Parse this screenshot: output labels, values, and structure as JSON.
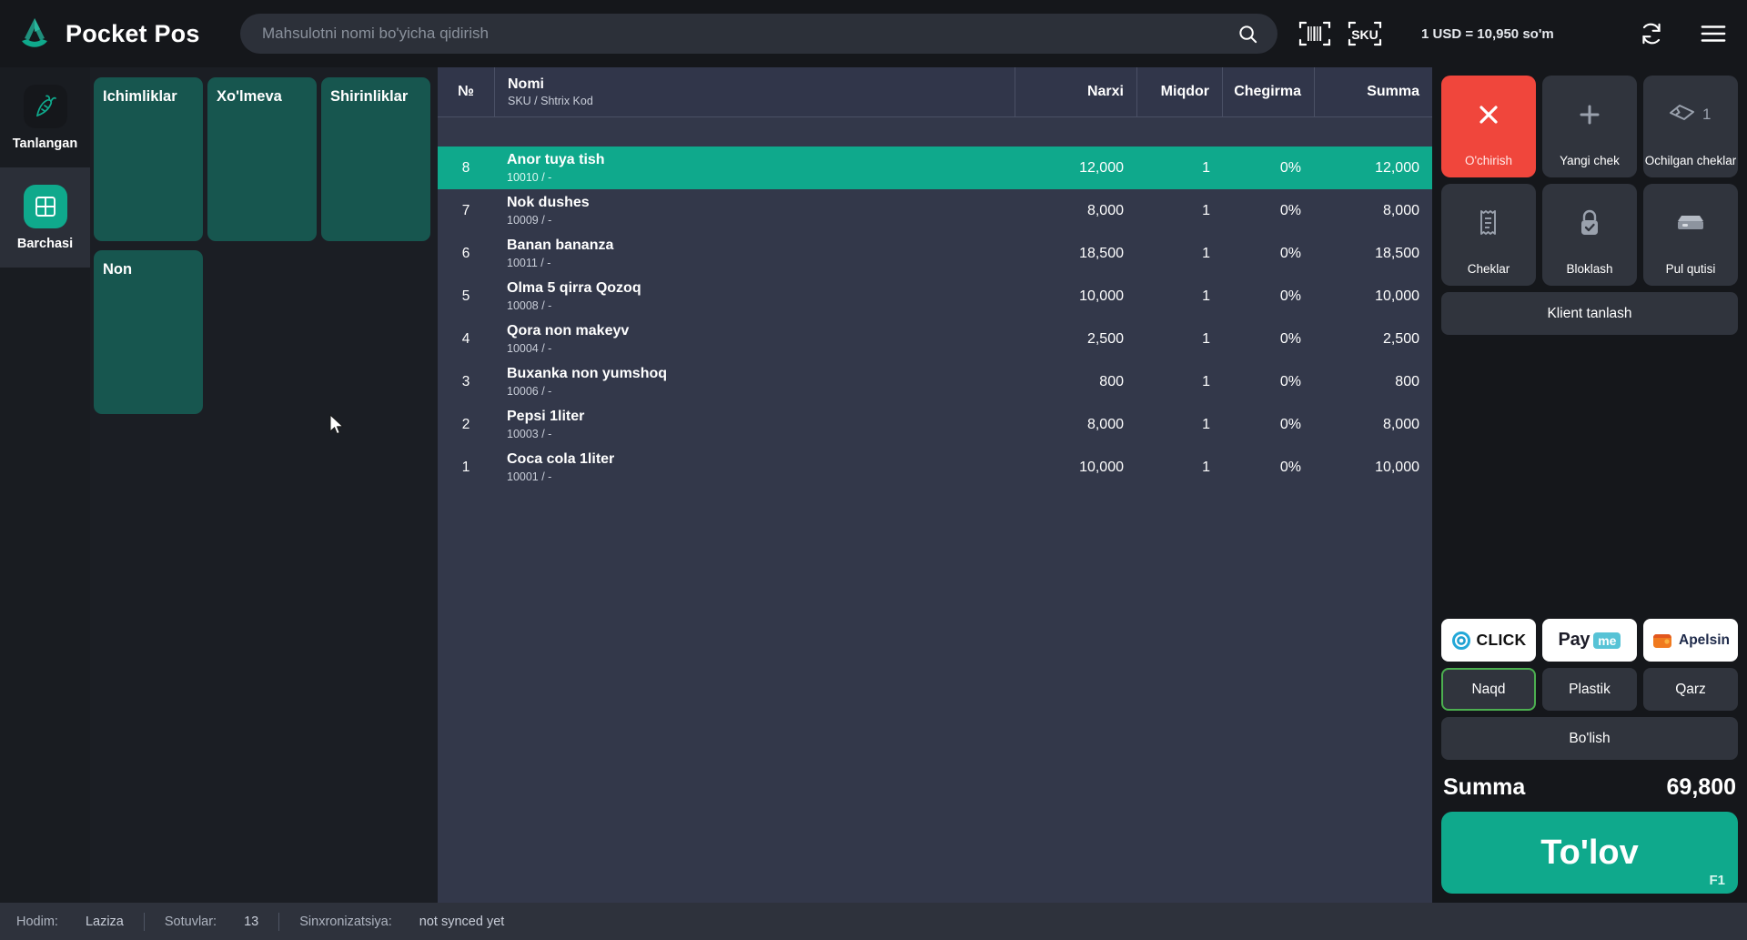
{
  "header": {
    "brand": "Pocket Pos",
    "search_placeholder": "Mahsulotni nomi bo'yicha qidirish",
    "search_value": "",
    "barcode_icon": "barcode-icon",
    "sku_icon": "sku-icon",
    "exchange_rate": "1 USD = 10,950 so'm",
    "sync_icon": "refresh-icon",
    "menu_icon": "hamburger-menu-icon"
  },
  "rail": {
    "items": [
      {
        "label": "Tanlangan",
        "icon": "carrot-icon",
        "selected": false
      },
      {
        "label": "Barchasi",
        "icon": "grid-icon",
        "selected": true
      }
    ]
  },
  "categories": [
    {
      "label": "Ichimliklar"
    },
    {
      "label": "Xo'lmeva"
    },
    {
      "label": "Shirinliklar"
    },
    {
      "label": "Non"
    }
  ],
  "cart": {
    "columns": {
      "num": "№",
      "name": "Nomi",
      "name_sub": "SKU / Shtrix Kod",
      "price": "Narxi",
      "qty": "Miqdor",
      "discount": "Chegirma",
      "sum": "Summa"
    },
    "rows": [
      {
        "num": "8",
        "name": "Anor tuya tish",
        "sku": "10010 / -",
        "price": "12,000",
        "qty": "1",
        "discount": "0%",
        "sum": "12,000",
        "selected": true
      },
      {
        "num": "7",
        "name": "Nok dushes",
        "sku": "10009 / -",
        "price": "8,000",
        "qty": "1",
        "discount": "0%",
        "sum": "8,000",
        "selected": false
      },
      {
        "num": "6",
        "name": "Banan bananza",
        "sku": "10011 / -",
        "price": "18,500",
        "qty": "1",
        "discount": "0%",
        "sum": "18,500",
        "selected": false
      },
      {
        "num": "5",
        "name": "Olma 5 qirra Qozoq",
        "sku": "10008 / -",
        "price": "10,000",
        "qty": "1",
        "discount": "0%",
        "sum": "10,000",
        "selected": false
      },
      {
        "num": "4",
        "name": "Qora non makeyv",
        "sku": "10004 / -",
        "price": "2,500",
        "qty": "1",
        "discount": "0%",
        "sum": "2,500",
        "selected": false
      },
      {
        "num": "3",
        "name": "Buxanka non yumshoq",
        "sku": "10006 / -",
        "price": "800",
        "qty": "1",
        "discount": "0%",
        "sum": "800",
        "selected": false
      },
      {
        "num": "2",
        "name": "Pepsi 1liter",
        "sku": "10003 / -",
        "price": "8,000",
        "qty": "1",
        "discount": "0%",
        "sum": "8,000",
        "selected": false
      },
      {
        "num": "1",
        "name": "Coca cola 1liter",
        "sku": "10001 / -",
        "price": "10,000",
        "qty": "1",
        "discount": "0%",
        "sum": "10,000",
        "selected": false
      }
    ]
  },
  "actions": [
    {
      "label": "O'chirish",
      "icon": "close-x-icon",
      "style": "danger"
    },
    {
      "label": "Yangi chek",
      "icon": "plus-icon",
      "style": "normal"
    },
    {
      "label": "Ochilgan cheklar",
      "icon": "ticket-icon",
      "badge": "1",
      "style": "normal"
    },
    {
      "label": "Cheklar",
      "icon": "receipt-icon",
      "style": "normal"
    },
    {
      "label": "Bloklash",
      "icon": "lock-icon",
      "style": "normal"
    },
    {
      "label": "Pul qutisi",
      "icon": "cash-drawer-icon",
      "style": "normal"
    }
  ],
  "client_button": "Klient tanlash",
  "payment_logos": [
    {
      "name": "CLICK",
      "icon": "click-logo"
    },
    {
      "name": "Payme",
      "icon": "payme-logo",
      "part1": "Pay",
      "part2": "me"
    },
    {
      "name": "Apelsin",
      "icon": "apelsin-logo"
    }
  ],
  "payment_methods": [
    {
      "label": "Naqd",
      "active": true
    },
    {
      "label": "Plastik",
      "active": false
    },
    {
      "label": "Qarz",
      "active": false
    }
  ],
  "split_button": "Bo'lish",
  "summary": {
    "label": "Summa",
    "value": "69,800"
  },
  "pay_button": {
    "label": "To'lov",
    "shortcut": "F1"
  },
  "status_bar": {
    "employee_label": "Hodim:",
    "employee_value": "Laziza",
    "sales_label": "Sotuvlar:",
    "sales_value": "13",
    "sync_label": "Sinxronizatsiya:",
    "sync_value": "not synced yet"
  },
  "colors": {
    "accent_teal": "#0fa98c",
    "category_tile": "#17564f",
    "danger_red": "#f0463c",
    "active_green": "#4caf50"
  }
}
